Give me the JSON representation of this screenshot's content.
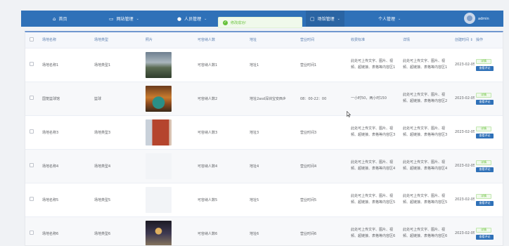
{
  "nav": {
    "items": [
      {
        "icon": "home-icon",
        "glyph": "⌂",
        "label": "首页",
        "caret": ""
      },
      {
        "icon": "monitor-icon",
        "glyph": "▭",
        "label": "网站管理",
        "caret": "⌄"
      },
      {
        "icon": "user-icon",
        "glyph": "●",
        "label": "人员管理",
        "caret": "⌄"
      },
      {
        "icon": "venue-icon",
        "glyph": "▢",
        "label": "场馆管理",
        "caret": "⌄"
      },
      {
        "icon": "",
        "glyph": "",
        "label": "个人管理",
        "caret": "⌄"
      }
    ],
    "username": "admin"
  },
  "toast": {
    "text": "修改成功!",
    "icon": "check-icon"
  },
  "table": {
    "columns": [
      "场地名称",
      "场地类型",
      "照片",
      "可容纳人数",
      "地址",
      "营业时间",
      "收费标准",
      "详情",
      "创建时间",
      "操作"
    ],
    "sort_glyph": "⇕",
    "detail_label": "详情",
    "review_label": "查看评论",
    "rows": [
      {
        "name": "场地名称1",
        "type": "场地类型1",
        "photo": "p1",
        "capacity": "可容纳人数1",
        "address": "地址1",
        "hours": "营业时间1",
        "fee": "此处可上传文字、图片、视频、超链接、表格等内容区1",
        "detail": "此处可上传文字、图片、视频、超链接、表格等内容区1",
        "created": "2023-02-05 1"
      },
      {
        "name": "国笼篮球馆",
        "type": "篮球",
        "photo": "p2",
        "capacity": "可容纳人数2",
        "address": "地址2asd深圳宝安西乡",
        "hours": "08：00-22：00",
        "fee": "一小时50，两小时150",
        "detail": "此处可上传文字、图片、视频、超链接、表格等内容区2",
        "created": "2023-02-05 1"
      },
      {
        "name": "场地名称3",
        "type": "场地类型3",
        "photo": "p3",
        "capacity": "可容纳人数3",
        "address": "地址3",
        "hours": "营业时间3",
        "fee": "此处可上传文字、图片、视频、超链接、表格等内容区3",
        "detail": "此处可上传文字、图片、视频、超链接、表格等内容区3",
        "created": "2023-02-05 1"
      },
      {
        "name": "场地名称4",
        "type": "场地类型4",
        "photo": "blank",
        "capacity": "可容纳人数4",
        "address": "地址4",
        "hours": "营业时间4",
        "fee": "此处可上传文字、图片、视频、超链接、表格等内容区4",
        "detail": "此处可上传文字、图片、视频、超链接、表格等内容区4",
        "created": "2023-02-05 1"
      },
      {
        "name": "场地名称5",
        "type": "场地类型5",
        "photo": "blank",
        "capacity": "可容纳人数5",
        "address": "地址5",
        "hours": "营业时间5",
        "fee": "此处可上传文字、图片、视频、超链接、表格等内容区5",
        "detail": "此处可上传文字、图片、视频、超链接、表格等内容区5",
        "created": "2023-02-05 1"
      },
      {
        "name": "场地名称6",
        "type": "场地类型6",
        "photo": "p4",
        "capacity": "可容纳人数6",
        "address": "地址6",
        "hours": "营业时间6",
        "fee": "此处可上传文字、图片、视频、超链接、表格等内容区6",
        "detail": "此处可上传文字、图片、视频、超链接、表格等内容区6",
        "created": "2023-02-05 1"
      }
    ]
  },
  "colors": {
    "nav_bg": "#2f71b8",
    "success": "#67c23a",
    "primary": "#2f71b8"
  }
}
